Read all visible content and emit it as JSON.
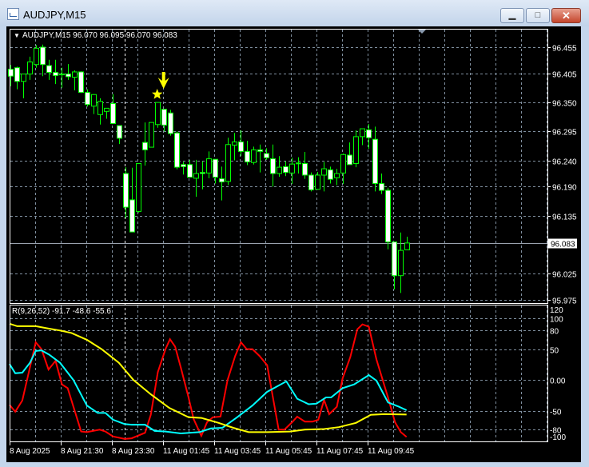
{
  "window": {
    "title": "AUDJPY,M15",
    "minimize_glyph": "▁",
    "maximize_glyph": "□",
    "close_glyph": "✕"
  },
  "chart": {
    "header": "AUDJPY,M15  96.070 96.095 96.070 96.083",
    "current_price": "96.083",
    "current_price_value": 96.083,
    "price_labels": [
      "96.455",
      "96.405",
      "96.350",
      "96.295",
      "96.240",
      "96.190",
      "96.135",
      "96.025",
      "95.975"
    ],
    "time_labels": [
      "8 Aug 2025",
      "8 Aug 21:30",
      "8 Aug 23:30",
      "11 Aug 01:45",
      "11 Aug 03:45",
      "11 Aug 05:45",
      "11 Aug 07:45",
      "11 Aug 09:45"
    ],
    "colors": {
      "bull_body": "#000000",
      "bear_body": "#ffffff",
      "wick": "#00ff00",
      "grid": "#8090a0",
      "arrow": "#ffff00"
    },
    "signal_star_candle": 24,
    "signal_arrow_candle": 25
  },
  "chart_data": [
    {
      "type": "candlestick",
      "title": "AUDJPY,M15",
      "ylim": [
        95.975,
        96.455
      ],
      "ohlc": [
        [
          96.413,
          96.421,
          96.381,
          96.4
        ],
        [
          96.416,
          96.418,
          96.375,
          96.39
        ],
        [
          96.39,
          96.404,
          96.358,
          96.404
        ],
        [
          96.404,
          96.437,
          96.393,
          96.427
        ],
        [
          96.422,
          96.459,
          96.416,
          96.453
        ],
        [
          96.455,
          96.46,
          96.4,
          96.422
        ],
        [
          96.42,
          96.431,
          96.393,
          96.407
        ],
        [
          96.407,
          96.431,
          96.385,
          96.401
        ],
        [
          96.404,
          96.416,
          96.378,
          96.404
        ],
        [
          96.404,
          96.423,
          96.393,
          96.399
        ],
        [
          96.398,
          96.411,
          96.373,
          96.408
        ],
        [
          96.408,
          96.409,
          96.368,
          96.369
        ],
        [
          96.369,
          96.375,
          96.342,
          96.346
        ],
        [
          96.343,
          96.366,
          96.328,
          96.365
        ],
        [
          96.327,
          96.358,
          96.308,
          96.352
        ],
        [
          96.333,
          96.339,
          96.319,
          96.339
        ],
        [
          96.348,
          96.366,
          96.31,
          96.31
        ],
        [
          96.306,
          96.306,
          96.271,
          96.282
        ],
        [
          96.215,
          96.227,
          96.13,
          96.151
        ],
        [
          96.165,
          96.226,
          96.104,
          96.104
        ],
        [
          96.143,
          96.234,
          96.141,
          96.234
        ],
        [
          96.274,
          96.312,
          96.23,
          96.26
        ],
        [
          96.265,
          96.312,
          96.265,
          96.312
        ],
        [
          96.308,
          96.35,
          96.302,
          96.35
        ],
        [
          96.337,
          96.337,
          96.295,
          96.307
        ],
        [
          96.33,
          96.336,
          96.287,
          96.291
        ],
        [
          96.292,
          96.295,
          96.223,
          96.227
        ],
        [
          96.232,
          96.237,
          96.213,
          96.228
        ],
        [
          96.232,
          96.241,
          96.208,
          96.208
        ],
        [
          96.206,
          96.241,
          96.171,
          96.215
        ],
        [
          96.217,
          96.238,
          96.185,
          96.215
        ],
        [
          96.216,
          96.257,
          96.206,
          96.243
        ],
        [
          96.242,
          96.242,
          96.196,
          96.208
        ],
        [
          96.205,
          96.228,
          96.164,
          96.199
        ],
        [
          96.2,
          96.283,
          96.193,
          96.27
        ],
        [
          96.269,
          96.292,
          96.24,
          96.275
        ],
        [
          96.275,
          96.297,
          96.248,
          96.257
        ],
        [
          96.257,
          96.277,
          96.231,
          96.237
        ],
        [
          96.236,
          96.266,
          96.232,
          96.26
        ],
        [
          96.26,
          96.27,
          96.217,
          96.257
        ],
        [
          96.253,
          96.263,
          96.241,
          96.245
        ],
        [
          96.243,
          96.27,
          96.19,
          96.215
        ],
        [
          96.215,
          96.248,
          96.209,
          96.227
        ],
        [
          96.228,
          96.238,
          96.21,
          96.217
        ],
        [
          96.216,
          96.245,
          96.195,
          96.233
        ],
        [
          96.235,
          96.246,
          96.215,
          96.235
        ],
        [
          96.234,
          96.256,
          96.205,
          96.212
        ],
        [
          96.212,
          96.217,
          96.181,
          96.184
        ],
        [
          96.185,
          96.218,
          96.185,
          96.212
        ],
        [
          96.212,
          96.237,
          96.181,
          96.224
        ],
        [
          96.222,
          96.228,
          96.196,
          96.204
        ],
        [
          96.207,
          96.224,
          96.193,
          96.215
        ],
        [
          96.216,
          96.253,
          96.195,
          96.251
        ],
        [
          96.25,
          96.274,
          96.232,
          96.232
        ],
        [
          96.234,
          96.297,
          96.227,
          96.285
        ],
        [
          96.285,
          96.3,
          96.269,
          96.3
        ],
        [
          96.298,
          96.309,
          96.262,
          96.283
        ],
        [
          96.28,
          96.304,
          96.181,
          96.196
        ],
        [
          96.196,
          96.215,
          96.176,
          96.183
        ],
        [
          96.183,
          96.188,
          96.071,
          96.085
        ],
        [
          96.085,
          96.085,
          95.995,
          96.021
        ],
        [
          96.021,
          96.103,
          95.988,
          96.069
        ],
        [
          96.07,
          96.095,
          96.07,
          96.083
        ]
      ]
    },
    {
      "type": "line",
      "title": "R(9,26,52) -91.7 -48.6 -55.6",
      "ylim": [
        -100,
        120
      ],
      "y_ticks": [
        "120",
        "100",
        "80",
        "50",
        "0.00",
        "-50",
        "-80",
        "-100"
      ],
      "y_tick_values": [
        120,
        100,
        80,
        50,
        0,
        -50,
        -80,
        -100
      ],
      "x_unit": "candle index",
      "series": [
        {
          "name": "fast",
          "color": "#ff0000",
          "points": [
            [
              0.9,
              -40
            ],
            [
              1.8,
              -51
            ],
            [
              2.9,
              -33
            ],
            [
              5,
              61
            ],
            [
              5.9,
              50
            ],
            [
              7,
              17
            ],
            [
              8.1,
              31
            ],
            [
              9.1,
              -7
            ],
            [
              10,
              -13
            ],
            [
              12.1,
              -83
            ],
            [
              13,
              -84
            ],
            [
              15,
              -80
            ],
            [
              15.9,
              -83
            ],
            [
              17.1,
              -91
            ],
            [
              18.9,
              -95
            ],
            [
              20,
              -94
            ],
            [
              22.1,
              -85
            ],
            [
              23,
              -56
            ],
            [
              24.1,
              13
            ],
            [
              25.3,
              50
            ],
            [
              26,
              66
            ],
            [
              26.8,
              54
            ],
            [
              27.7,
              20
            ],
            [
              28.9,
              -28
            ],
            [
              29.7,
              -63
            ],
            [
              30.9,
              -90
            ],
            [
              31.8,
              -68
            ],
            [
              32.7,
              -60
            ],
            [
              33.9,
              -59
            ],
            [
              35,
              0
            ],
            [
              36.2,
              39
            ],
            [
              37.1,
              61
            ],
            [
              38,
              50
            ],
            [
              38.9,
              50
            ],
            [
              40,
              39
            ],
            [
              41.2,
              24
            ],
            [
              43,
              -80
            ],
            [
              43.9,
              -80
            ],
            [
              45.1,
              -68
            ],
            [
              45.9,
              -59
            ],
            [
              47.1,
              -67
            ],
            [
              48.3,
              -67
            ],
            [
              49.2,
              -64
            ],
            [
              50.1,
              -32
            ],
            [
              50.9,
              -55
            ],
            [
              52.1,
              -43
            ],
            [
              53,
              3
            ],
            [
              54.2,
              37
            ],
            [
              55.3,
              82
            ],
            [
              56.1,
              90
            ],
            [
              57.1,
              86
            ],
            [
              58.3,
              33
            ],
            [
              60.1,
              -28
            ],
            [
              61.2,
              -68
            ],
            [
              62.1,
              -84
            ],
            [
              63,
              -91.7
            ]
          ]
        },
        {
          "name": "medium",
          "color": "#00ffff",
          "points": [
            [
              0.9,
              26
            ],
            [
              1.8,
              11
            ],
            [
              2.9,
              12
            ],
            [
              4.1,
              28
            ],
            [
              5,
              47
            ],
            [
              5.9,
              48
            ],
            [
              7.1,
              41
            ],
            [
              8.8,
              28
            ],
            [
              10.9,
              0
            ],
            [
              13,
              -41
            ],
            [
              14.7,
              -53
            ],
            [
              15.9,
              -53
            ],
            [
              17.1,
              -64
            ],
            [
              18.9,
              -71
            ],
            [
              20,
              -72
            ],
            [
              22.1,
              -72
            ],
            [
              23.6,
              -82
            ],
            [
              25.3,
              -83
            ],
            [
              27.7,
              -86
            ],
            [
              30.6,
              -84
            ],
            [
              32.4,
              -78
            ],
            [
              34.2,
              -77
            ],
            [
              36.5,
              -60
            ],
            [
              38.9,
              -41
            ],
            [
              41.2,
              -19
            ],
            [
              44.2,
              -2
            ],
            [
              45.9,
              -30
            ],
            [
              47.7,
              -39
            ],
            [
              48.9,
              -38
            ],
            [
              50.4,
              -28
            ],
            [
              51.2,
              -28
            ],
            [
              53,
              -13
            ],
            [
              54.8,
              -7
            ],
            [
              57.1,
              8
            ],
            [
              58.3,
              -1
            ],
            [
              60.1,
              -36
            ],
            [
              61.8,
              -43
            ],
            [
              63,
              -48.6
            ]
          ]
        },
        {
          "name": "slow",
          "color": "#ffff00",
          "points": [
            [
              0.9,
              91
            ],
            [
              2.1,
              87
            ],
            [
              5,
              87
            ],
            [
              7.1,
              83
            ],
            [
              8.8,
              80
            ],
            [
              10.6,
              76
            ],
            [
              13,
              65
            ],
            [
              15.3,
              50
            ],
            [
              18,
              28
            ],
            [
              20.3,
              0
            ],
            [
              23,
              -23
            ],
            [
              25.9,
              -45
            ],
            [
              28.9,
              -60
            ],
            [
              30.9,
              -61
            ],
            [
              33.6,
              -69
            ],
            [
              35.9,
              -77
            ],
            [
              38.3,
              -84
            ],
            [
              41.2,
              -84
            ],
            [
              44.8,
              -83
            ],
            [
              47.1,
              -80
            ],
            [
              50.1,
              -79
            ],
            [
              52.4,
              -76
            ],
            [
              55.1,
              -69
            ],
            [
              57.4,
              -56
            ],
            [
              59.5,
              -55
            ],
            [
              63,
              -55.6
            ]
          ]
        }
      ]
    }
  ]
}
